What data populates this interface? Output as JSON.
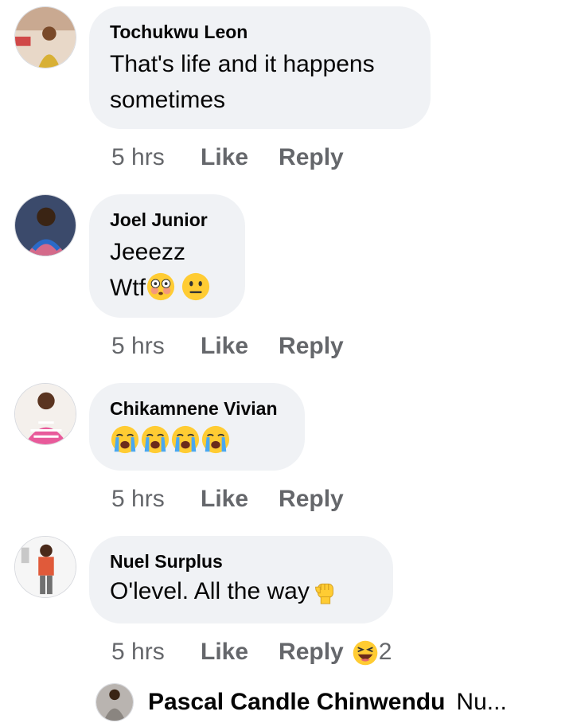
{
  "comments": [
    {
      "author": "Tochukwu Leon",
      "text_lines": [
        "That's life and it happens",
        "sometimes"
      ],
      "time": "5 hrs",
      "like": "Like",
      "reply": "Reply",
      "avatar_icon": "profile-photo"
    },
    {
      "author": "Joel Junior",
      "text_lines": [
        "Jeeezz",
        "Wtf"
      ],
      "emojis": [
        "flushed-face-emoji",
        "neutral-face-emoji"
      ],
      "time": "5 hrs",
      "like": "Like",
      "reply": "Reply",
      "avatar_icon": "profile-photo"
    },
    {
      "author": "Chikamnene Vivian",
      "emojis": [
        "crying-face-emoji",
        "crying-face-emoji",
        "crying-face-emoji",
        "crying-face-emoji"
      ],
      "time": "5 hrs",
      "like": "Like",
      "reply": "Reply",
      "avatar_icon": "profile-photo"
    },
    {
      "author": "Nuel Surplus",
      "text_lines": [
        "O'level.  All the way"
      ],
      "emojis": [
        "raised-fist-emoji"
      ],
      "time": "5 hrs",
      "like": "Like",
      "reply": "Reply",
      "reaction_icon": "laughing-reaction-icon",
      "reaction_count": "2",
      "avatar_icon": "profile-photo"
    }
  ],
  "reply_preview": {
    "author": "Pascal Candle Chinwendu",
    "snippet": "Nu..."
  },
  "colors": {
    "bubble": "#f0f2f5",
    "meta_text": "#65676b",
    "text": "#050505",
    "emoji_yellow": "#ffcc33"
  }
}
